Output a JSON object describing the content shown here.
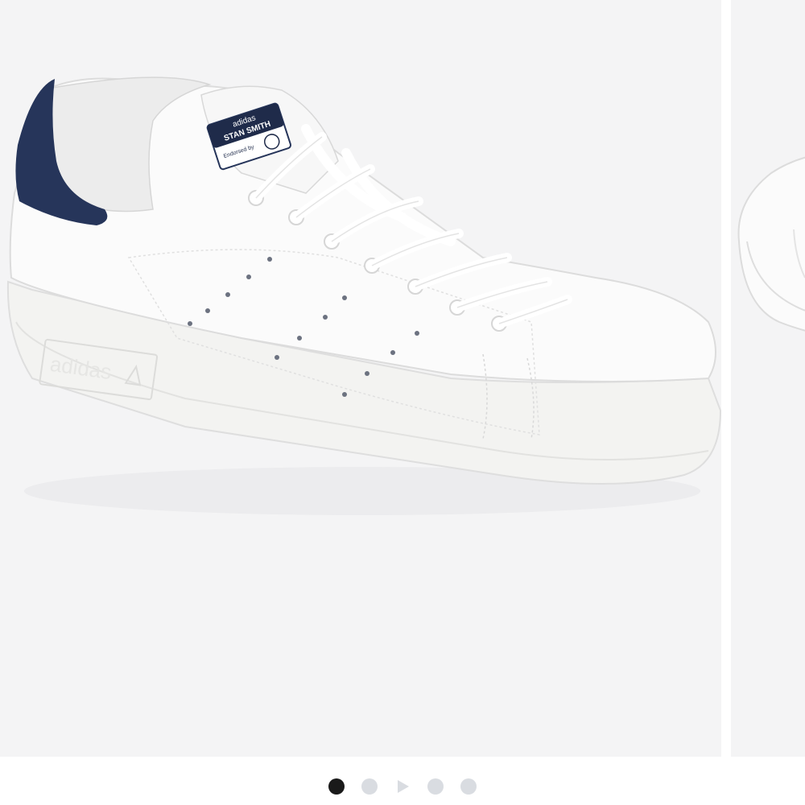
{
  "gallery": {
    "slide_count": 5,
    "active_index": 0,
    "indicators": [
      {
        "type": "image",
        "active": true
      },
      {
        "type": "image",
        "active": false
      },
      {
        "type": "video",
        "active": false
      },
      {
        "type": "image",
        "active": false
      },
      {
        "type": "image",
        "active": false
      }
    ],
    "colors": {
      "slide_background": "#f4f4f5",
      "dot_active": "#1a1a1a",
      "dot_inactive": "#d9dce1",
      "shoe_white": "#fbfbfb",
      "heel_tab_navy": "#26355a"
    }
  },
  "product_image": {
    "tongue_label_lines": [
      "adidas",
      "STAN SMITH",
      "Endorsed by"
    ],
    "sole_logo_text": "adidas"
  }
}
